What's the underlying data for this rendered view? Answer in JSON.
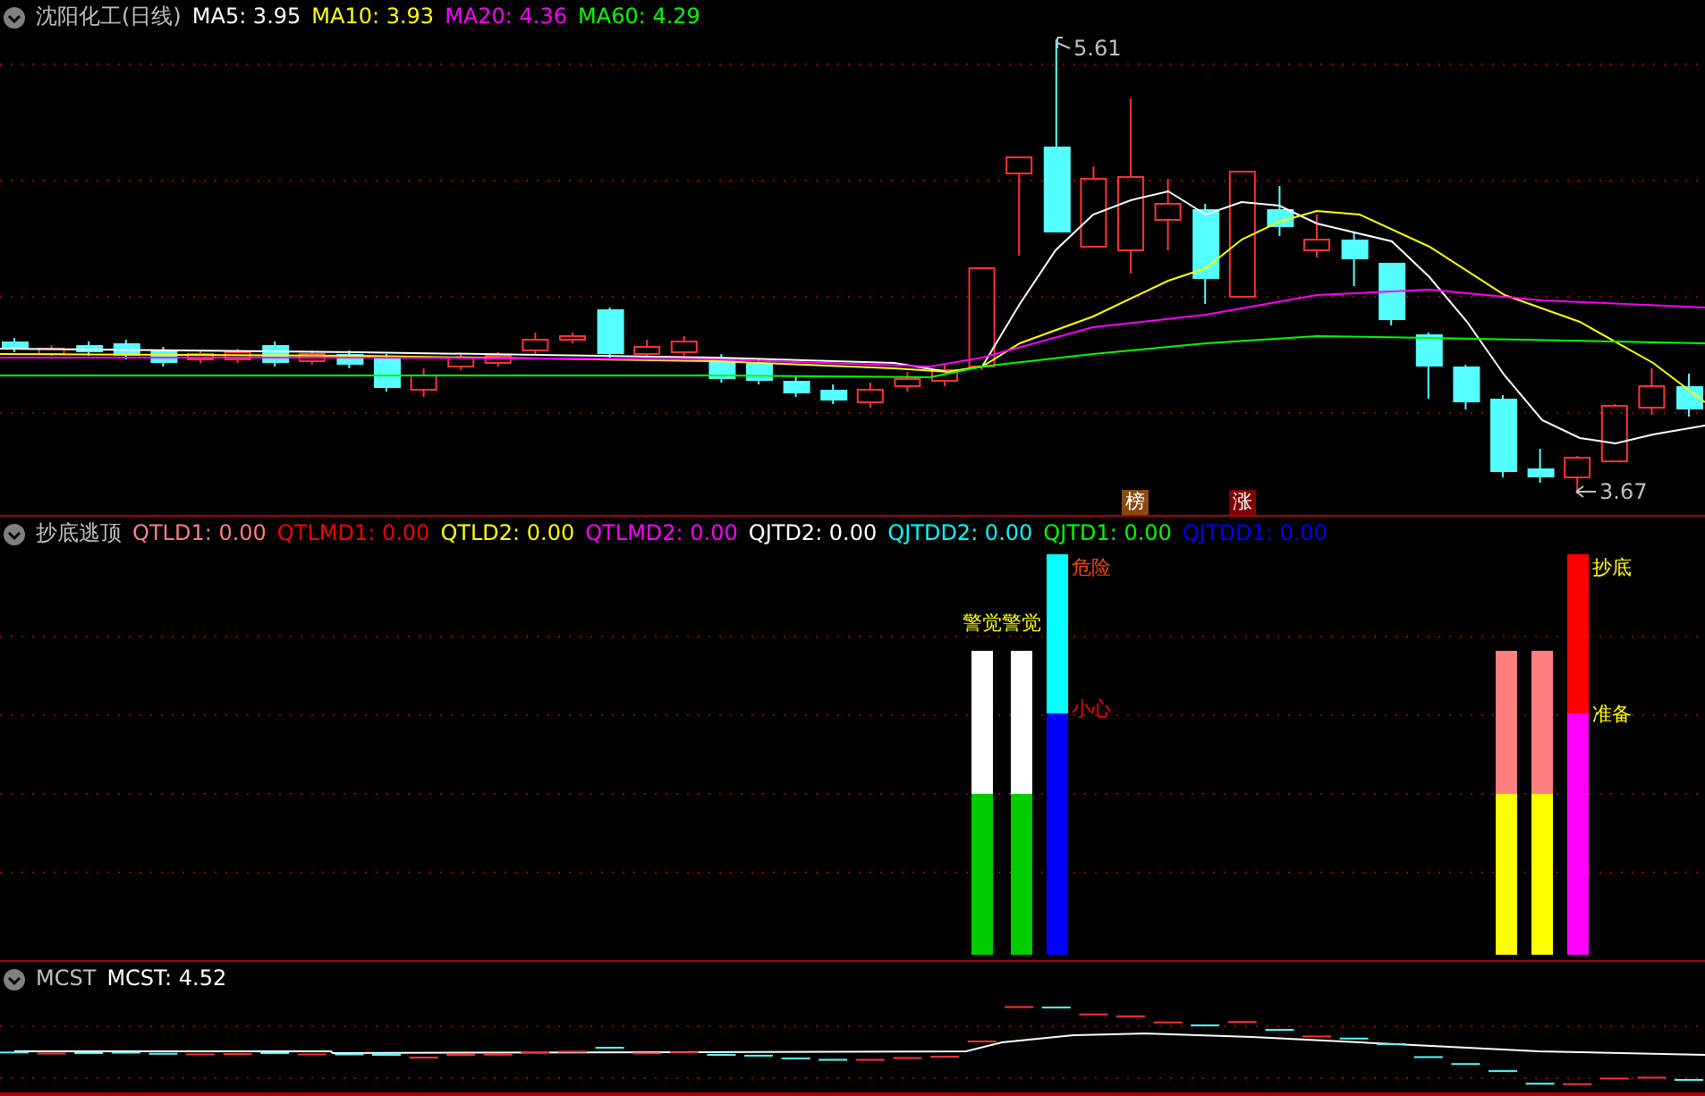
{
  "main_panel": {
    "title": "沈阳化工(日线)",
    "indicators": [
      {
        "label": "MA5: 3.95",
        "color": "#ffffff"
      },
      {
        "label": "MA10: 3.93",
        "color": "#ffff00"
      },
      {
        "label": "MA20: 4.36",
        "color": "#ff00ff"
      },
      {
        "label": "MA60: 4.29",
        "color": "#00ff00"
      }
    ],
    "high_label": "5.61",
    "low_label": "3.67",
    "badges": [
      {
        "text": "榜",
        "color": "#8b4a14"
      },
      {
        "text": "涨",
        "color": "#800000"
      }
    ]
  },
  "signal_panel": {
    "title": "抄底逃顶",
    "indicators": [
      {
        "label": "QTLD1: 0.00",
        "color": "#ff7f7f"
      },
      {
        "label": "QTLMD1: 0.00",
        "color": "#ff0000"
      },
      {
        "label": "QTLD2: 0.00",
        "color": "#ffff00"
      },
      {
        "label": "QTLMD2: 0.00",
        "color": "#ff00ff"
      },
      {
        "label": "QJTD2: 0.00",
        "color": "#ffffff"
      },
      {
        "label": "QJTDD2: 0.00",
        "color": "#00ffff"
      },
      {
        "label": "QJTD1: 0.00",
        "color": "#00ff00"
      },
      {
        "label": "QJTDD1: 0.00",
        "color": "#0000ff"
      }
    ],
    "signals": [
      {
        "text": "警觉警觉",
        "color": "#ffff00"
      },
      {
        "text": "危险",
        "color": "#ff4500"
      },
      {
        "text": "小心",
        "color": "#ff0000"
      },
      {
        "text": "抄底",
        "color": "#ffff00"
      },
      {
        "text": "准备",
        "color": "#ffff00"
      }
    ]
  },
  "cost_panel": {
    "title": "MCST",
    "indicators": [
      {
        "label": "MCST: 4.52",
        "color": "#ffffff"
      }
    ]
  }
}
